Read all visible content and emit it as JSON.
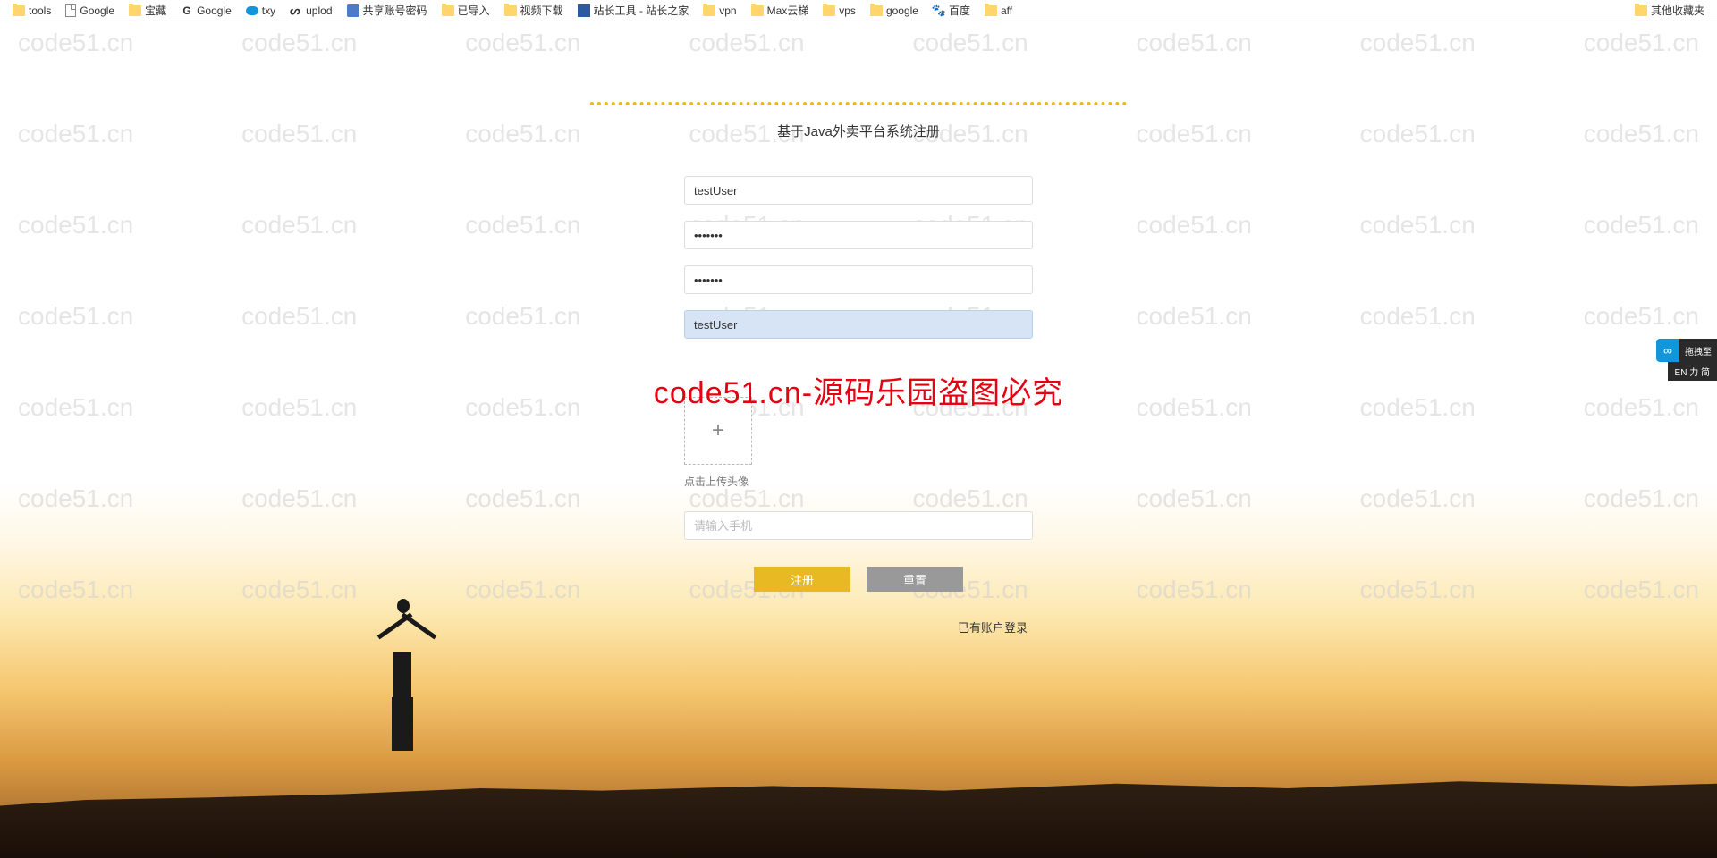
{
  "bookmarks": {
    "left": [
      {
        "icon": "folder",
        "label": "tools"
      },
      {
        "icon": "page",
        "label": "Google"
      },
      {
        "icon": "folder",
        "label": "宝藏"
      },
      {
        "icon": "google",
        "label": "Google"
      },
      {
        "icon": "cloud",
        "label": "txy"
      },
      {
        "icon": "up",
        "label": "uplod"
      },
      {
        "icon": "app",
        "label": "共享账号密码"
      },
      {
        "icon": "folder",
        "label": "已导入"
      },
      {
        "icon": "folder",
        "label": "视频下载"
      },
      {
        "icon": "tool",
        "label": "站长工具 - 站长之家"
      },
      {
        "icon": "folder",
        "label": "vpn"
      },
      {
        "icon": "folder",
        "label": "Max云梯"
      },
      {
        "icon": "folder",
        "label": "vps"
      },
      {
        "icon": "folder",
        "label": "google"
      },
      {
        "icon": "baidu",
        "label": "百度"
      },
      {
        "icon": "folder",
        "label": "aff"
      }
    ],
    "right": [
      {
        "icon": "folder",
        "label": "其他收藏夹"
      }
    ]
  },
  "watermark": "code51.cn",
  "form": {
    "title": "基于Java外卖平台系统注册",
    "username_value": "testUser",
    "password_value": "•••••••",
    "confirm_password_value": "•••••••",
    "nickname_value": "testUser",
    "upload_label": "点击上传头像",
    "phone_placeholder": "请输入手机",
    "register_btn": "注册",
    "reset_btn": "重置",
    "login_link": "已有账户登录"
  },
  "overlay_text": "code51.cn-源码乐园盗图必究",
  "side": {
    "drag_label": "拖拽至",
    "lang_label": "EN 力 简"
  }
}
